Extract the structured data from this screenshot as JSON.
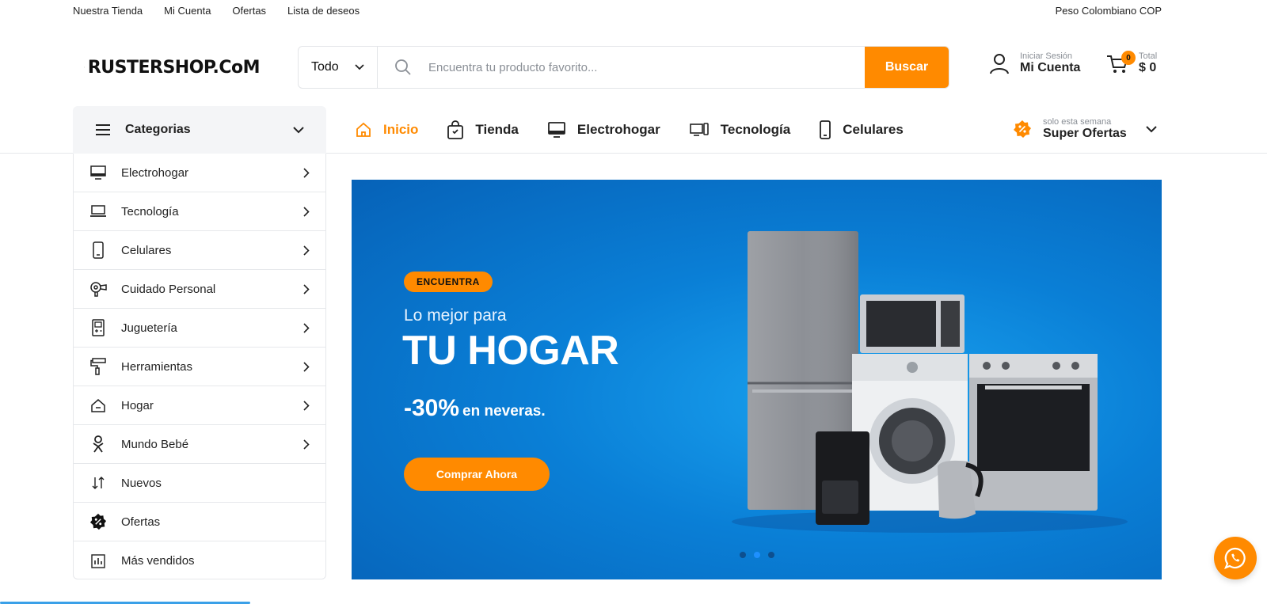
{
  "topbar": {
    "links": [
      "Nuestra Tienda",
      "Mi Cuenta",
      "Ofertas",
      "Lista de deseos"
    ],
    "currency": "Peso Colombiano COP"
  },
  "logo": {
    "text": "RUSTERSHOP.CoM"
  },
  "search": {
    "category": "Todo",
    "placeholder": "Encuentra tu producto favorito...",
    "button": "Buscar"
  },
  "account": {
    "small": "Iniciar Sesión",
    "big": "Mi Cuenta"
  },
  "cart": {
    "count": "0",
    "small": "Total",
    "big": "$ 0"
  },
  "categories_toggle": "Categorias",
  "mainnav": [
    {
      "label": "Inicio",
      "icon": "home-icon",
      "active": true
    },
    {
      "label": "Tienda",
      "icon": "shopping-bag-icon"
    },
    {
      "label": "Electrohogar",
      "icon": "monitor-icon"
    },
    {
      "label": "Tecnología",
      "icon": "devices-icon"
    },
    {
      "label": "Celulares",
      "icon": "phone-icon"
    }
  ],
  "offers": {
    "small": "solo esta semana",
    "big": "Super Ofertas"
  },
  "sidebar": [
    {
      "label": "Electrohogar",
      "icon": "monitor-icon",
      "arrow": true
    },
    {
      "label": "Tecnología",
      "icon": "laptop-icon",
      "arrow": true
    },
    {
      "label": "Celulares",
      "icon": "phone-icon",
      "arrow": true
    },
    {
      "label": "Cuidado Personal",
      "icon": "hair-dryer-icon",
      "arrow": true
    },
    {
      "label": "Juguetería",
      "icon": "game-console-icon",
      "arrow": true
    },
    {
      "label": "Herramientas",
      "icon": "paint-roller-icon",
      "arrow": true
    },
    {
      "label": "Hogar",
      "icon": "house-icon",
      "arrow": true
    },
    {
      "label": "Mundo Bebé",
      "icon": "baby-icon",
      "arrow": true
    },
    {
      "label": "Nuevos",
      "icon": "sort-icon",
      "arrow": false
    },
    {
      "label": "Ofertas",
      "icon": "discount-badge-icon",
      "arrow": false
    },
    {
      "label": "Más vendidos",
      "icon": "bar-chart-icon",
      "arrow": false
    }
  ],
  "hero": {
    "tag": "ENCUENTRA",
    "subtitle": "Lo mejor para",
    "title": "TU HOGAR",
    "promo_pct": "-30%",
    "promo_rest": "en neveras.",
    "cta": "Comprar Ahora",
    "slides": 3,
    "active_slide": 2
  },
  "colors": {
    "accent": "#ff8a00",
    "hero_blue": "#0a7fd6",
    "text": "#222222"
  }
}
